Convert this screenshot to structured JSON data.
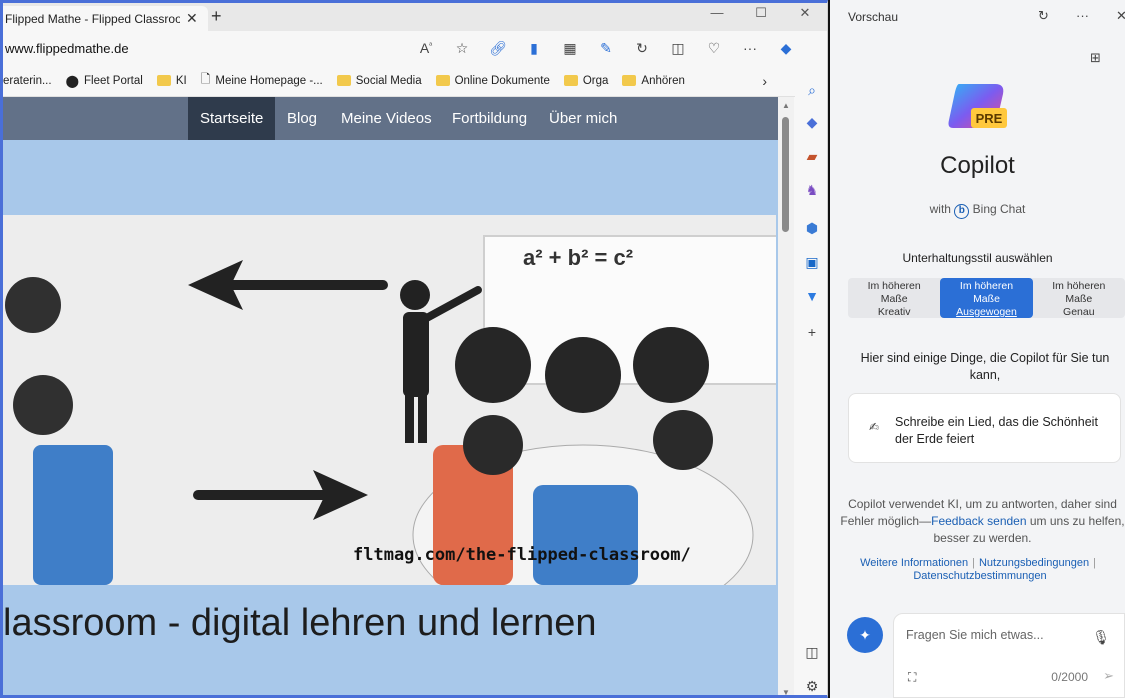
{
  "browser": {
    "tab_title": "Flipped Mathe - Flipped Classroo",
    "tab_close": "✕",
    "new_tab": "+",
    "window_min": "—",
    "window_max": "☐",
    "window_close": "✕",
    "url": "www.flippedmathe.de",
    "favorites": [
      {
        "label": "eraterin...",
        "icon": "none"
      },
      {
        "label": "Fleet Portal",
        "icon": "github-icon"
      },
      {
        "label": "KI",
        "icon": "folder-icon"
      },
      {
        "label": "Meine Homepage -...",
        "icon": "page-icon"
      },
      {
        "label": "Social Media",
        "icon": "folder-icon"
      },
      {
        "label": "Online Dokumente",
        "icon": "folder-icon"
      },
      {
        "label": "Orga",
        "icon": "folder-icon"
      },
      {
        "label": "Anhören",
        "icon": "folder-icon"
      }
    ],
    "fav_more": "›"
  },
  "site": {
    "nav": [
      "Startseite",
      "Blog",
      "Meine Videos",
      "Fortbildung",
      "Über mich"
    ],
    "active_nav": "Startseite",
    "formula": "a² + b² = c²",
    "caption": "fltmag.com/the-flipped-classroom/",
    "headline": "lassroom - digital lehren und lernen"
  },
  "copilot": {
    "pane_title": "Vorschau",
    "badge": "PRE",
    "name": "Copilot",
    "with_prefix": "with",
    "with_service": "Bing Chat",
    "style_label": "Unterhaltungsstil auswählen",
    "styles": [
      {
        "line1": "Im höheren",
        "line2": "Maße",
        "line3": "Kreativ"
      },
      {
        "line1": "Im höheren",
        "line2": "Maße",
        "line3": "Ausgewogen"
      },
      {
        "line1": "Im höheren",
        "line2": "Maße",
        "line3": "Genau"
      }
    ],
    "selected_style": 1,
    "intro": "Hier sind einige Dinge, die Copilot für Sie tun kann,",
    "suggestion": "Schreibe ein Lied, das die Schönheit der Erde feiert",
    "disclaimer_pre": "Copilot verwendet KI, um zu antworten, daher sind Fehler möglich—",
    "disclaimer_link": "Feedback senden",
    "disclaimer_post": " um uns zu helfen, besser zu werden.",
    "link_more": "Weitere Informationen",
    "link_terms": "Nutzungsbedingungen",
    "link_privacy": "Datenschutzbestimmungen",
    "input_placeholder": "Fragen Sie mich etwas...",
    "counter": "0/2000"
  },
  "colors": {
    "accent": "#2b6fd6",
    "site_nav": "#627188",
    "site_bg": "#a8c8ea"
  }
}
